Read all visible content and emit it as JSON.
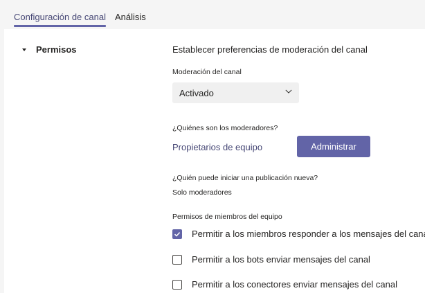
{
  "tabs": [
    {
      "label": "Configuración de canal",
      "active": true
    },
    {
      "label": "Análisis",
      "active": false
    }
  ],
  "section": {
    "title": "Permisos",
    "description": "Establecer preferencias de moderación del canal"
  },
  "moderation": {
    "label": "Moderación del canal",
    "selected": "Activado"
  },
  "moderators": {
    "label": "¿Quiénes son los moderadores?",
    "value": "Propietarios de equipo",
    "button": "Administrar"
  },
  "new_post": {
    "label": "¿Quién puede iniciar una publicación nueva?",
    "value": "Solo moderadores"
  },
  "member_permissions": {
    "label": "Permisos de miembros del equipo",
    "options": [
      {
        "label": "Permitir a los miembros responder a los mensajes del canal",
        "checked": true
      },
      {
        "label": "Permitir a los bots enviar mensajes del canal",
        "checked": false
      },
      {
        "label": "Permitir a los conectores enviar mensajes del canal",
        "checked": false
      }
    ]
  },
  "colors": {
    "accent": "#6264a7",
    "accent_text": "#464775",
    "background": "#f5f5f5",
    "panel": "#ffffff"
  }
}
